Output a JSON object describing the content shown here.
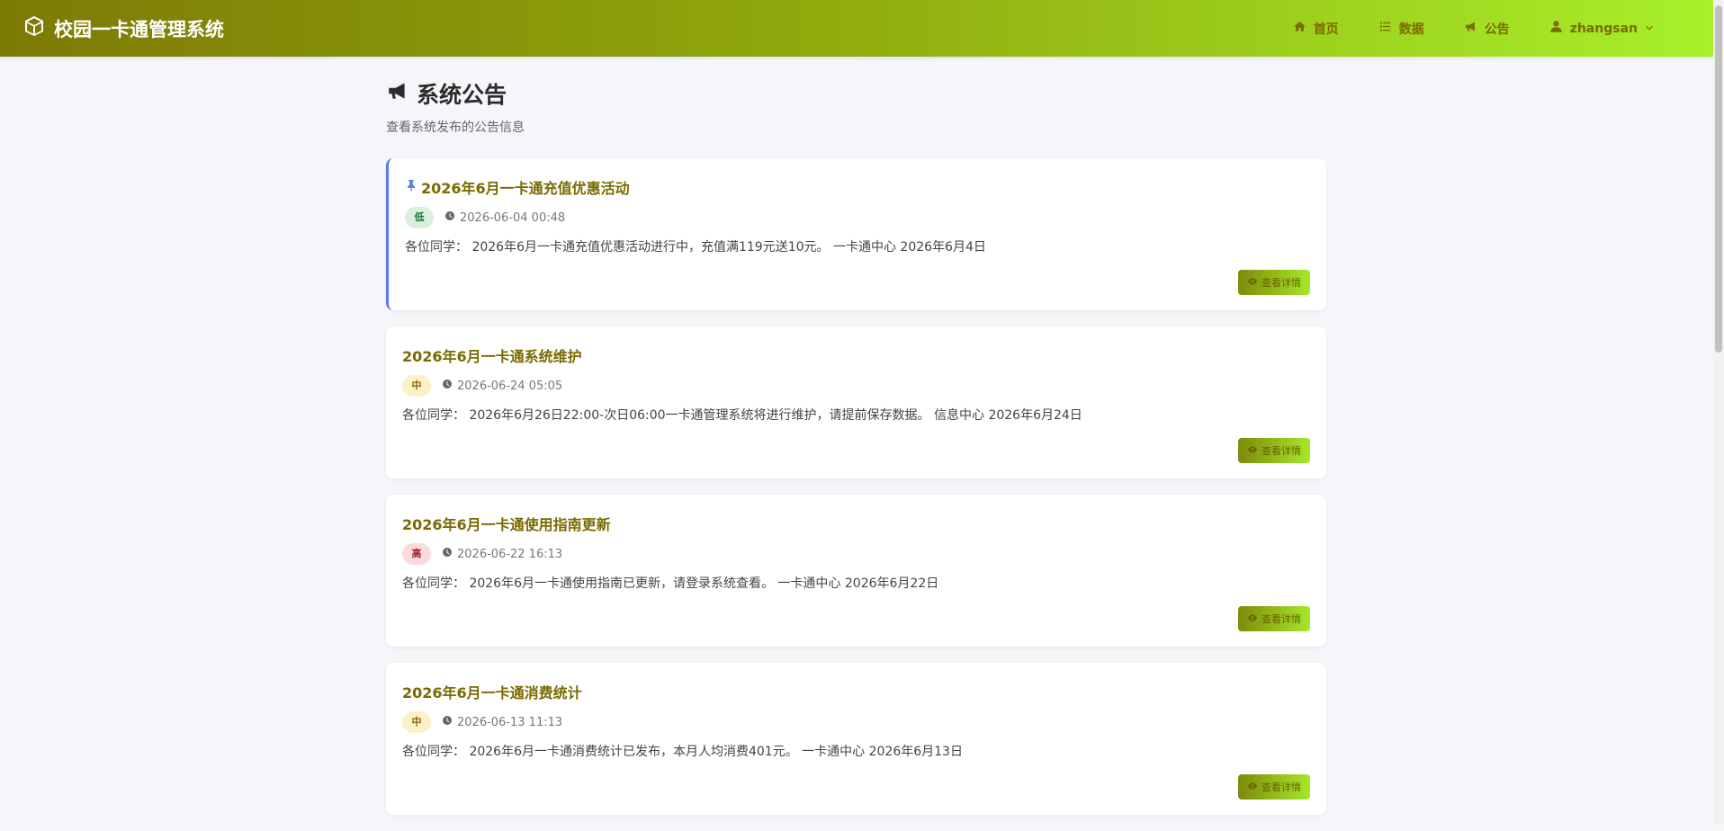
{
  "navbar": {
    "brand": "校园一卡通管理系统",
    "items": [
      {
        "label": "首页",
        "icon": "home-icon"
      },
      {
        "label": "数据",
        "icon": "list-icon"
      },
      {
        "label": "公告",
        "icon": "megaphone-icon"
      }
    ],
    "user": {
      "name": "zhangsan",
      "icon": "user-icon"
    }
  },
  "page": {
    "title": "系统公告",
    "subtitle": "查看系统发布的公告信息"
  },
  "notices": [
    {
      "title": "2026年6月一卡通充值优惠活动",
      "pinned": true,
      "priority": "低",
      "time": "2026-06-04 00:48",
      "body": "各位同学： 2026年6月一卡通充值优惠活动进行中，充值满119元送10元。 一卡通中心 2026年6月4日",
      "button": "查看详情"
    },
    {
      "title": "2026年6月一卡通系统维护",
      "pinned": false,
      "priority": "中",
      "time": "2026-06-24 05:05",
      "body": "各位同学： 2026年6月26日22:00-次日06:00一卡通管理系统将进行维护，请提前保存数据。 信息中心 2026年6月24日",
      "button": "查看详情"
    },
    {
      "title": "2026年6月一卡通使用指南更新",
      "pinned": false,
      "priority": "高",
      "time": "2026-06-22 16:13",
      "body": "各位同学： 2026年6月一卡通使用指南已更新，请登录系统查看。 一卡通中心 2026年6月22日",
      "button": "查看详情"
    },
    {
      "title": "2026年6月一卡通消费统计",
      "pinned": false,
      "priority": "中",
      "time": "2026-06-13 11:13",
      "body": "各位同学： 2026年6月一卡通消费统计已发布，本月人均消费401元。 一卡通中心 2026年6月13日",
      "button": "查看详情"
    }
  ],
  "colors": {
    "accent_text": "#7a6a00",
    "pin": "#5b7be0",
    "priority_low_bg": "#d9f0de",
    "priority_mid_bg": "#fdf1c9",
    "priority_high_bg": "#fbdadd"
  }
}
